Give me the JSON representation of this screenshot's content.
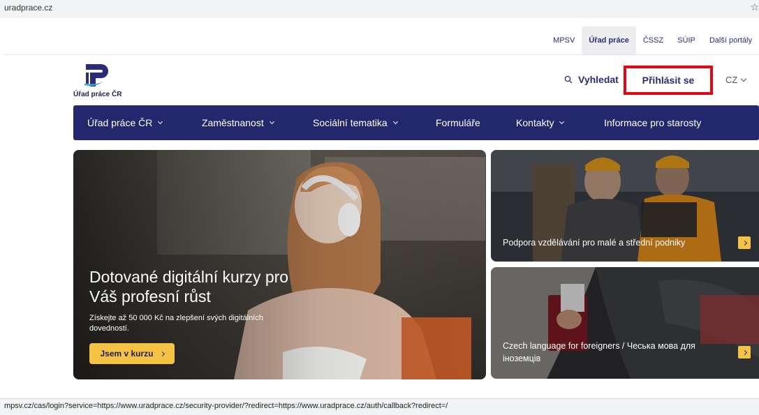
{
  "browser": {
    "address": "uradprace.cz",
    "bookmark_icon": "star-icon",
    "status_url": "mpsv.cz/cas/login?service=https://www.uradprace.cz/security-provider/?redirect=https://www.uradprace.cz/auth/callback?redirect=/"
  },
  "portals": [
    {
      "label": "MPSV",
      "active": false
    },
    {
      "label": "Úřad práce",
      "active": true
    },
    {
      "label": "ČSSZ",
      "active": false
    },
    {
      "label": "SÚIP",
      "active": false
    },
    {
      "label": "Další portály",
      "active": false
    }
  ],
  "logo": {
    "text": "Úřad práce ČR",
    "color": "#2a2c78"
  },
  "header": {
    "search_label": "Vyhledat",
    "search_icon": "search-icon",
    "login_label": "Přihlásit se",
    "login_highlight_color": "#e30613",
    "language": "CZ"
  },
  "nav": {
    "background": "#23286d",
    "items": [
      {
        "label": "Úřad práce ČR",
        "has_dropdown": true
      },
      {
        "label": "Zaměstnanost",
        "has_dropdown": true
      },
      {
        "label": "Sociální tematika",
        "has_dropdown": true
      },
      {
        "label": "Formuláře",
        "has_dropdown": false
      },
      {
        "label": "Kontakty",
        "has_dropdown": true
      },
      {
        "label": "Informace pro starosty",
        "has_dropdown": false
      }
    ]
  },
  "hero": {
    "title": "Dotované digitální kurzy pro Váš profesní růst",
    "subtitle": "Získejte až 50 000 Kč na zlepšení svých digitálních dovedností.",
    "cta_label": "Jsem v kurzu",
    "cta_color": "#f6c244"
  },
  "cards": [
    {
      "label": "Podpora vzdělávání pro malé a střední podniky"
    },
    {
      "label": "Czech language for foreigners / Чеська мова для іноземців"
    }
  ]
}
